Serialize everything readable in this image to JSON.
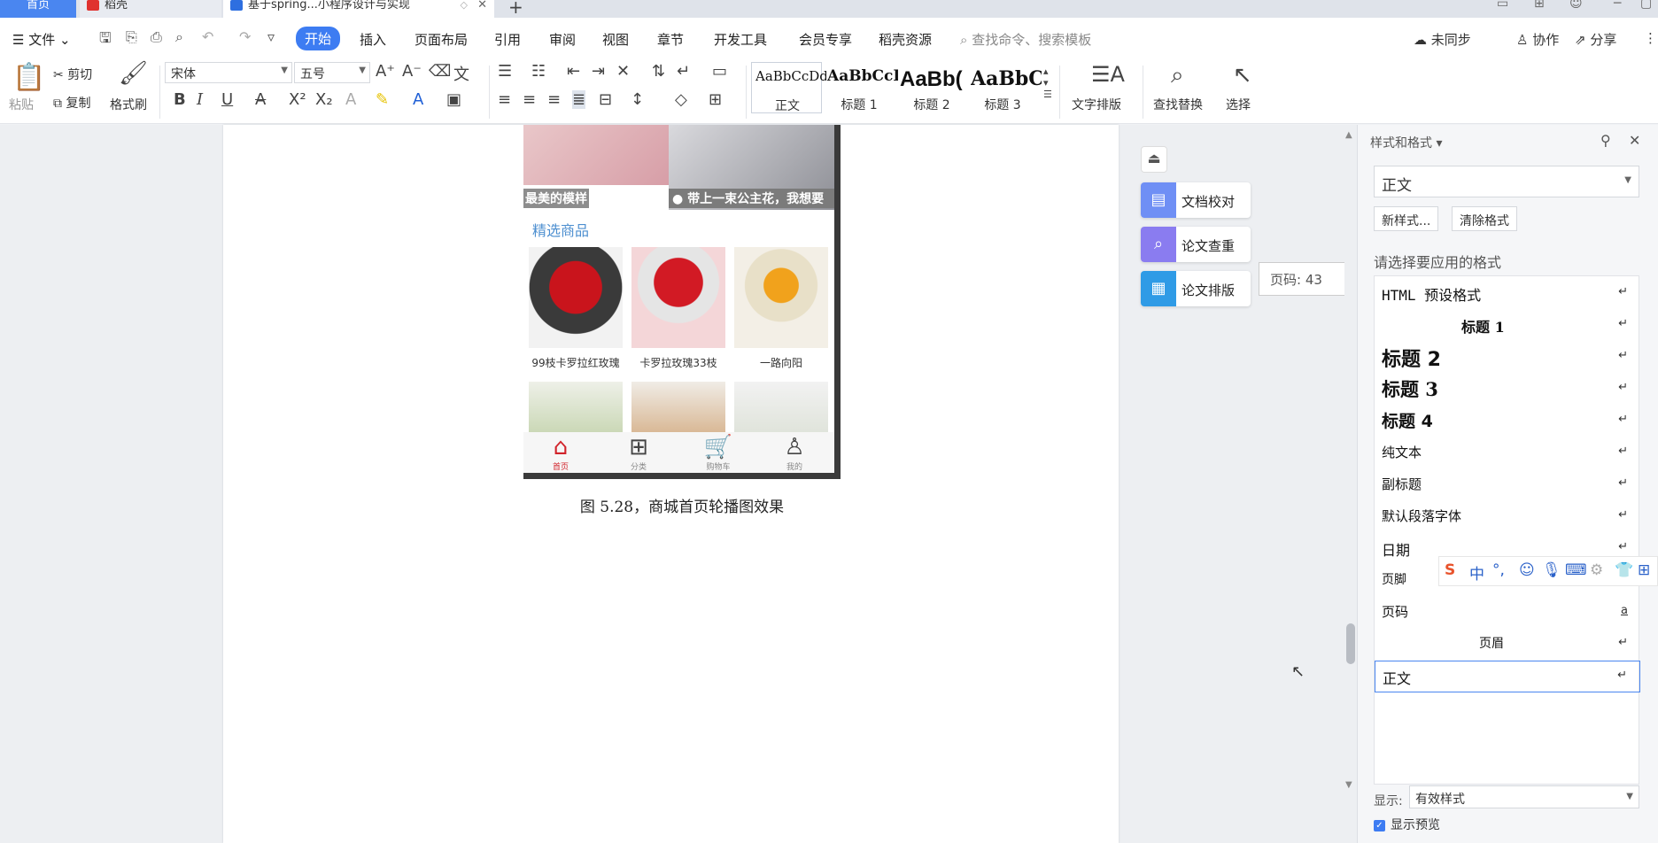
{
  "tabs": {
    "home": "首页",
    "daoke": "稻壳",
    "doc": "基于spring...小程序设计与实现"
  },
  "menu": {
    "file": "文件",
    "items": [
      "开始",
      "插入",
      "页面布局",
      "引用",
      "审阅",
      "视图",
      "章节",
      "开发工具",
      "会员专享",
      "稻壳资源"
    ],
    "search_placeholder": "查找命令、搜索模板",
    "sync": "未同步",
    "collab": "协作",
    "share": "分享"
  },
  "ribbon": {
    "paste": "粘贴",
    "cut": "剪切",
    "copy": "复制",
    "format_painter": "格式刷",
    "font": "宋体",
    "size": "五号",
    "styles": [
      {
        "preview": "AaBbCcDd",
        "label": "正文"
      },
      {
        "preview": "AaBbCcI",
        "label": "标题 1"
      },
      {
        "preview": "AaBb(",
        "label": "标题 2"
      },
      {
        "preview": "AaBbC",
        "label": "标题 3"
      }
    ],
    "text_layout": "文字排版",
    "find_replace": "查找替换",
    "select": "选择"
  },
  "document": {
    "banner_caption_1": "最美的模样",
    "banner_caption_2": "带上一束公主花，我想要",
    "featured_title": "精选商品",
    "products": [
      "99枝卡罗拉红玫瑰",
      "卡罗拉玫瑰33枝",
      "一路向阳"
    ],
    "nav": [
      "首页",
      "分类",
      "购物车",
      "我的"
    ],
    "figure_caption": "图 5.28，商城首页轮播图效果"
  },
  "sidetools": {
    "proofread": "文档校对",
    "plagiarism": "论文查重",
    "layout": "论文排版",
    "page_tip": "页码: 43"
  },
  "panel": {
    "title": "样式和格式",
    "current": "正文",
    "new_style": "新样式...",
    "clear_format": "清除格式",
    "hint": "请选择要应用的格式",
    "styles": [
      "HTML 预设格式",
      "标题 1",
      "标题 2",
      "标题 3",
      "标题 4",
      "纯文本",
      "副标题",
      "默认段落字体",
      "日期",
      "页脚",
      "页码",
      "页眉",
      "正文"
    ],
    "show_label": "显示:",
    "show_value": "有效样式",
    "preview_label": "显示预览"
  },
  "ime": {
    "lang": "中"
  },
  "colors": {
    "accent": "#3d7cf2",
    "home_tab": "#4a86f0",
    "nav_active": "#d1232a",
    "featured": "#4d8fd0"
  }
}
